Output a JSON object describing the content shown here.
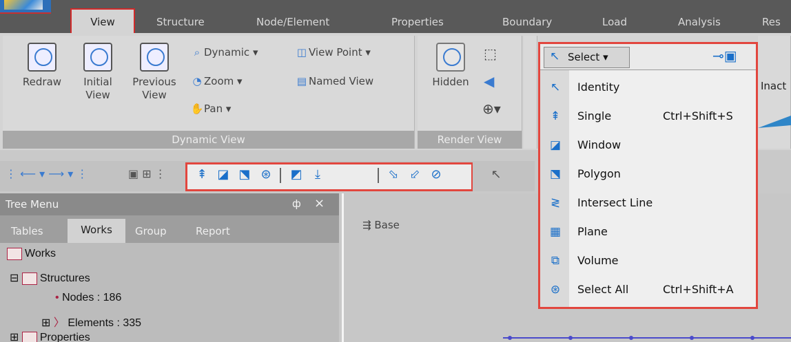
{
  "tabs": [
    "View",
    "Structure",
    "Node/Element",
    "Properties",
    "Boundary",
    "Load",
    "Analysis",
    "Res"
  ],
  "ribbon": {
    "dynamic_view": {
      "group_label": "Dynamic View",
      "redraw": "Redraw",
      "initial_view_1": "Initial",
      "initial_view_2": "View",
      "previous_view_1": "Previous",
      "previous_view_2": "View",
      "dynamic": "Dynamic",
      "zoom": "Zoom",
      "pan": "Pan",
      "view_point": "View Point",
      "named_view": "Named View"
    },
    "render_view": {
      "group_label": "Render View",
      "hidden": "Hidden"
    },
    "inactive_cut": "Inact"
  },
  "select_menu": {
    "button_label": "Select",
    "items": [
      {
        "label": "Identity",
        "shortcut": "",
        "icon": "identity-arrow-icon"
      },
      {
        "label": "Single",
        "shortcut": "Ctrl+Shift+S",
        "icon": "single-select-icon"
      },
      {
        "label": "Window",
        "shortcut": "",
        "icon": "window-select-icon"
      },
      {
        "label": "Polygon",
        "shortcut": "",
        "icon": "polygon-select-icon"
      },
      {
        "label": "Intersect Line",
        "shortcut": "",
        "icon": "intersect-line-icon"
      },
      {
        "label": "Plane",
        "shortcut": "",
        "icon": "plane-select-icon"
      },
      {
        "label": "Volume",
        "shortcut": "",
        "icon": "volume-select-icon"
      },
      {
        "label": "Select All",
        "shortcut": "Ctrl+Shift+A",
        "icon": "select-all-icon"
      }
    ]
  },
  "tree_menu": {
    "title": "Tree Menu",
    "pin": "ф",
    "close": "×",
    "tabs": [
      "Tables",
      "Works",
      "Group",
      "Report"
    ],
    "nodes": {
      "works": "Works",
      "structures": "Structures",
      "nodes": "Nodes : 186",
      "elements": "Elements : 335",
      "properties": "Properties"
    }
  },
  "canvas": {
    "base_label": "Base"
  },
  "colors": {
    "highlight": "#e2463e",
    "accent": "#1a6fc9"
  }
}
